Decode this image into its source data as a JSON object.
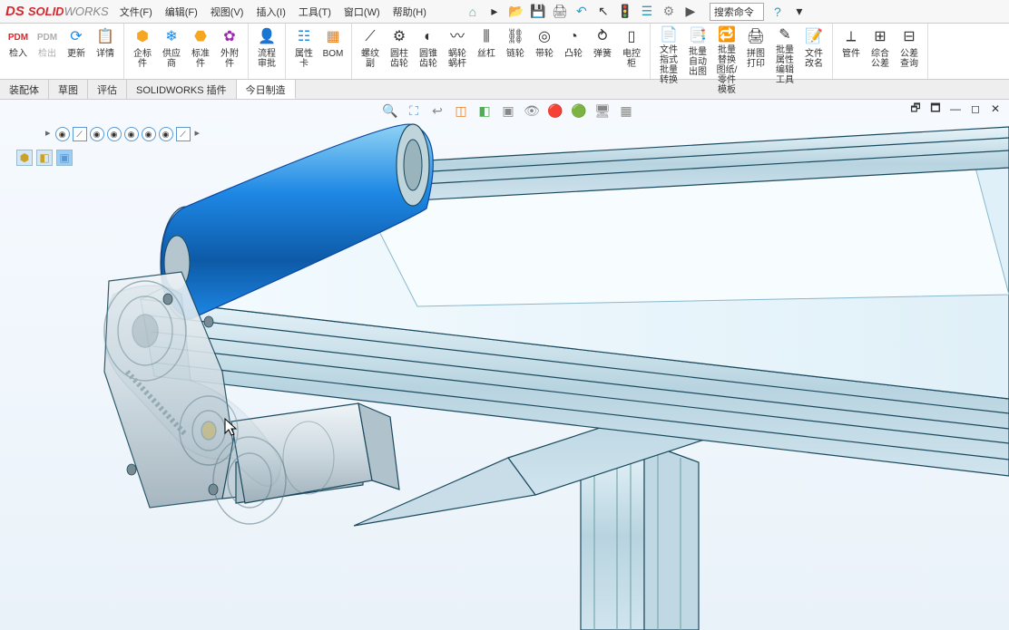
{
  "logo": {
    "prefix": "DS",
    "name1": "SOLID",
    "name2": "WORKS"
  },
  "menus": {
    "file": "文件(F)",
    "edit": "编辑(F)",
    "view": "视图(V)",
    "insert": "插入(I)",
    "tools": "工具(T)",
    "window": "窗口(W)",
    "help": "帮助(H)"
  },
  "search": {
    "placeholder": "搜索命令"
  },
  "toolbar": {
    "pdm_in": "检入",
    "pdm_out": "检出",
    "update": "更新",
    "details": "详情",
    "enterprise": "企标件",
    "supplier": "供应商",
    "standard": "标准件",
    "external": "外附件",
    "process": "流程审批",
    "attr_card": "属性卡",
    "bom": "BOM",
    "thread": "螺纹副",
    "cyl_gear": "圆柱齿轮",
    "bevel_gear": "圆锥齿轮",
    "worm": "蜗轮蜗杆",
    "rack": "丝杠",
    "chain": "链轮",
    "pulley": "带轮",
    "cam": "凸轮",
    "spring": "弹簧",
    "cabinet": "电控柜",
    "file_format": "文件指式批量转换",
    "batch_auto": "批量自动出图",
    "batch_replace": "批量替换图纸/零件模板",
    "batch_print": "拼图打印",
    "batch_attr": "批量属性编辑工具",
    "file_rename": "文件改名",
    "pipe": "管件",
    "tolerance": "综合公差",
    "fit": "公差查询"
  },
  "tabs": {
    "assembly": "装配体",
    "sketch": "草图",
    "evaluate": "评估",
    "addins": "SOLIDWORKS 插件",
    "today": "今日制造"
  }
}
